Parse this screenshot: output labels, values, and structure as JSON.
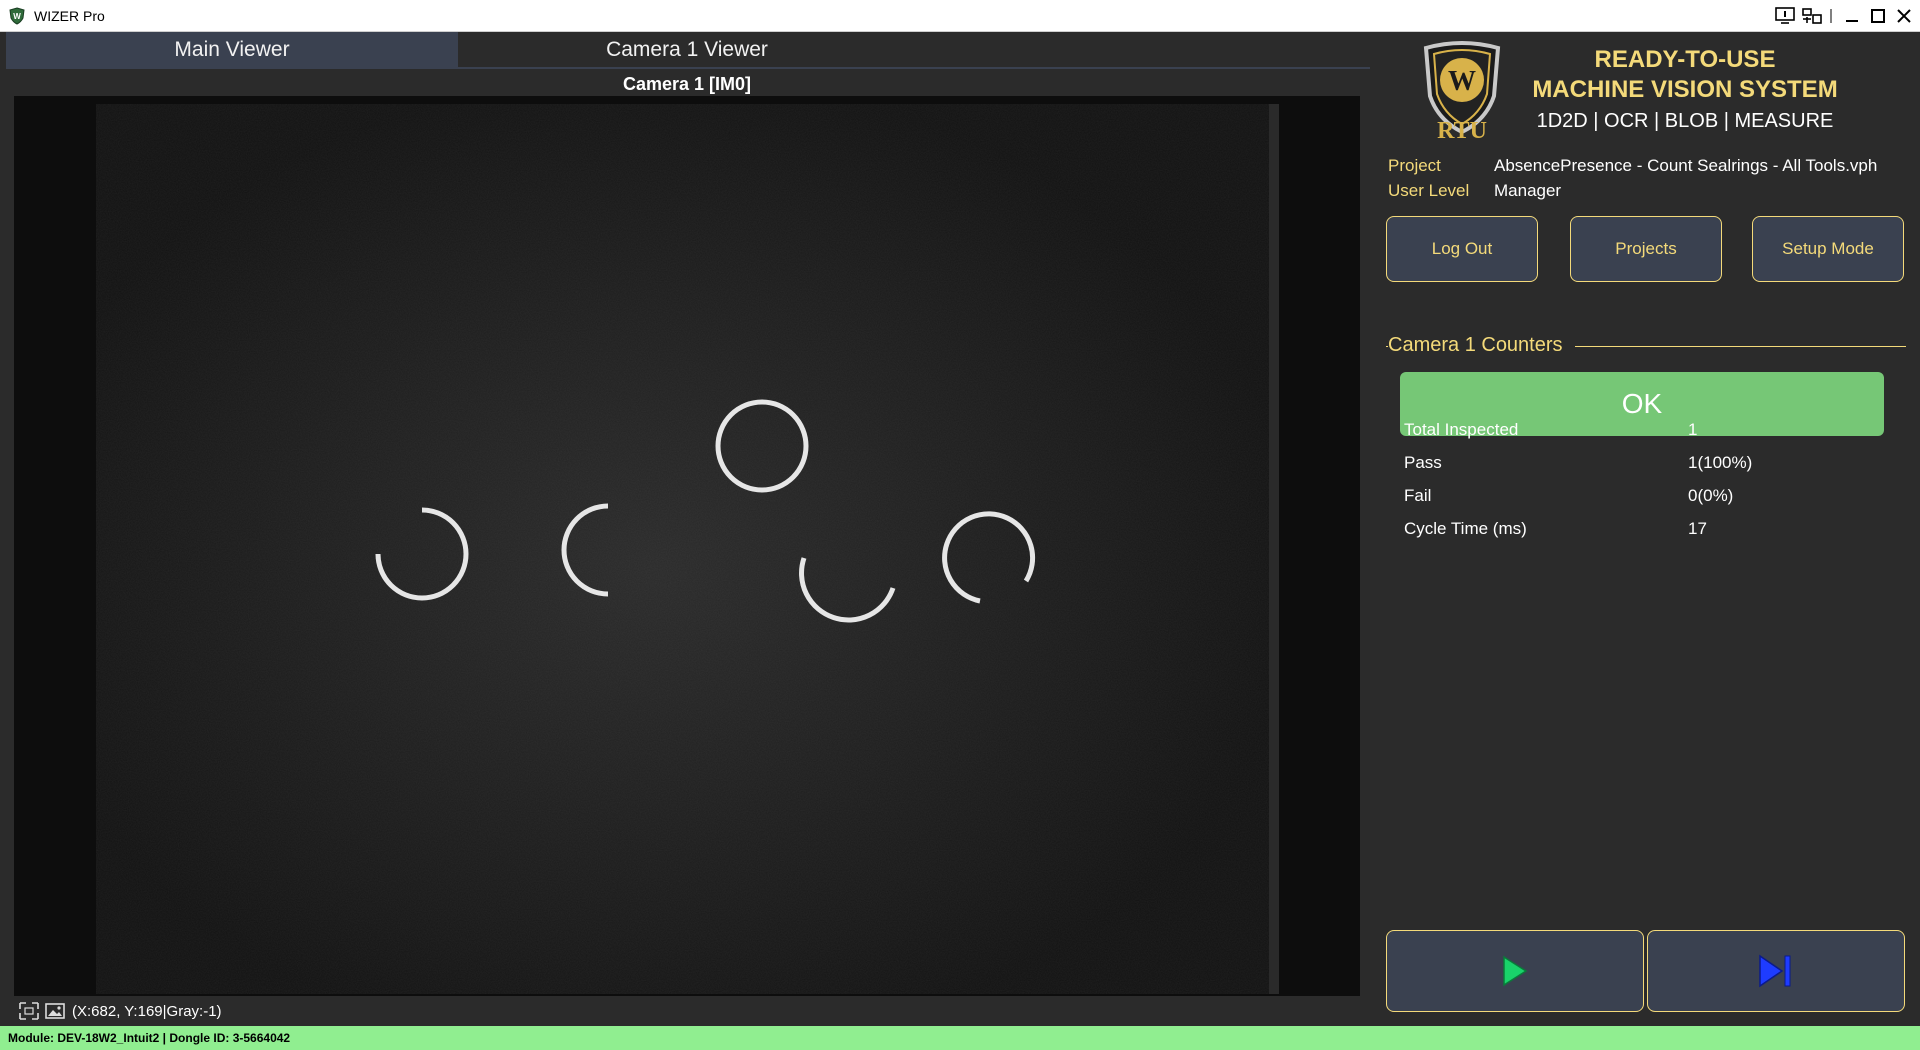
{
  "window": {
    "title": "WIZER Pro"
  },
  "tabs": [
    {
      "label": "Main Viewer",
      "active": true
    },
    {
      "label": "Camera 1 Viewer",
      "active": false
    }
  ],
  "viewer": {
    "title": "Camera 1  [IM0]",
    "coord_readout": "(X:682, Y:169|Gray:-1)"
  },
  "brand": {
    "logo_text": "RTU",
    "headline_1": "READY-TO-USE",
    "headline_2": "MACHINE VISION SYSTEM",
    "headline_3": "1D2D | OCR | BLOB | MEASURE"
  },
  "info": {
    "project_label": "Project",
    "project_value": "AbsencePresence - Count Sealrings - All Tools.vph",
    "user_level_label": "User Level",
    "user_level_value": "Manager"
  },
  "buttons": {
    "logout": "Log Out",
    "projects": "Projects",
    "setup_mode": "Setup Mode"
  },
  "counters": {
    "title": "Camera 1 Counters",
    "status": "OK",
    "rows": [
      {
        "label": "Total Inspected",
        "value": "1"
      },
      {
        "label": "Pass",
        "value": "1(100%)"
      },
      {
        "label": "Fail",
        "value": "0(0%)"
      },
      {
        "label": "Cycle Time (ms)",
        "value": "17"
      }
    ]
  },
  "statusbar": {
    "text": "Module: DEV-18W2_Intuit2 | Dongle ID: 3-5664042"
  },
  "colors": {
    "accent_gold": "#f4da7a",
    "panel_bg": "#2b2b2b",
    "button_bg": "#3a4150",
    "ok_green": "#76c776",
    "statusbar_green": "#90ee90",
    "play_green": "#19d36a",
    "step_blue": "#1e3cff"
  },
  "icons": {
    "app": "wizer-shield-icon",
    "play": "play-icon",
    "step": "step-forward-icon"
  }
}
